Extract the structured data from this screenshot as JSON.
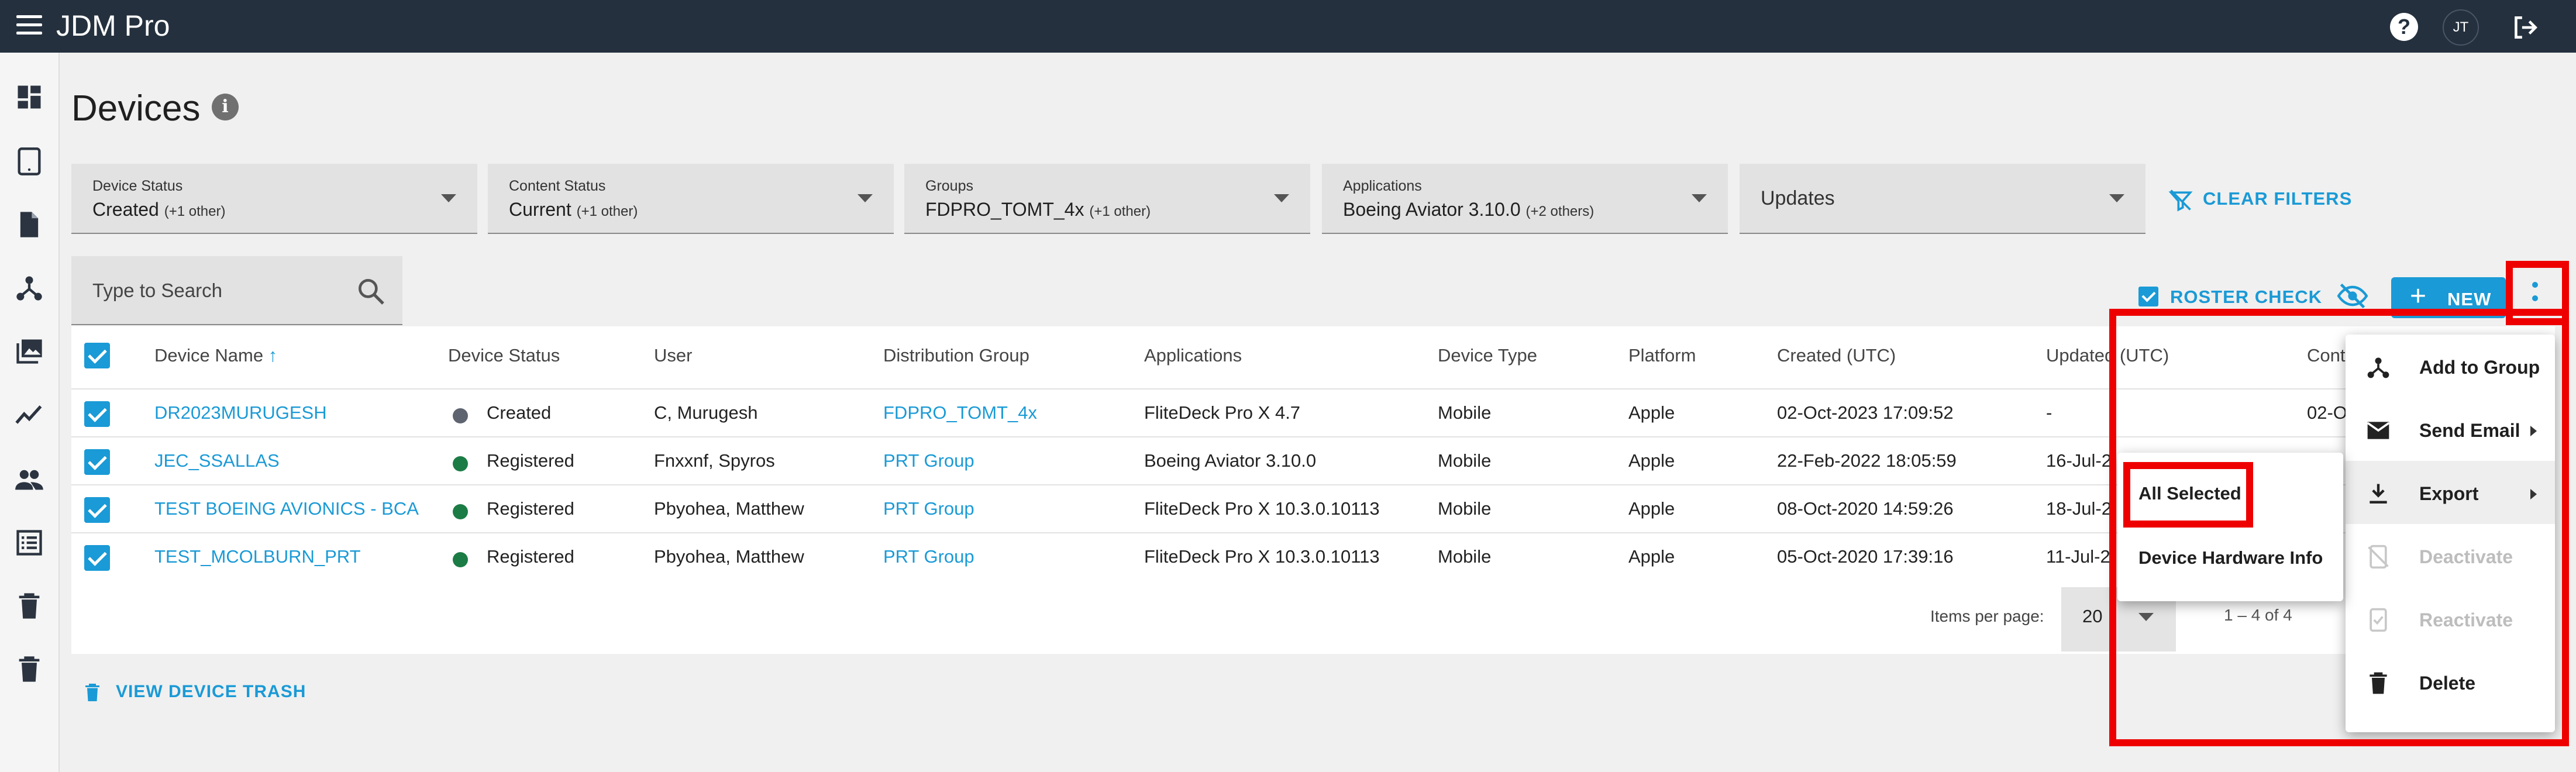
{
  "app": {
    "title": "JDM Pro",
    "user_initials": "JT"
  },
  "page": {
    "title": "Devices"
  },
  "filters": [
    {
      "label": "Device Status",
      "value": "Created",
      "extra": "(+1 other)"
    },
    {
      "label": "Content Status",
      "value": "Current",
      "extra": "(+1 other)"
    },
    {
      "label": "Groups",
      "value": "FDPRO_TOMT_4x",
      "extra": "(+1 other)"
    },
    {
      "label": "Applications",
      "value": "Boeing Aviator 3.10.0",
      "extra": "(+2 others)"
    },
    {
      "label": "",
      "value": "Updates",
      "extra": ""
    }
  ],
  "clear_filters": "CLEAR FILTERS",
  "search": {
    "placeholder": "Type to Search"
  },
  "toolbar": {
    "roster_check": "ROSTER CHECK",
    "new_label": "NEW"
  },
  "table": {
    "headers": [
      "Device Name",
      "Device Status",
      "User",
      "Distribution Group",
      "Applications",
      "Device Type",
      "Platform",
      "Created (UTC)",
      "Updated (UTC)",
      "Cont"
    ],
    "rows": [
      {
        "name": "DR2023MURUGESH",
        "status": "Created",
        "status_color": "#5e6470",
        "user": "C, Murugesh",
        "group": "FDPRO_TOMT_4x",
        "apps": "FliteDeck Pro X 4.7",
        "type": "Mobile",
        "platform": "Apple",
        "created": "02-Oct-2023 17:09:52",
        "updated": "-",
        "cont": "02-O"
      },
      {
        "name": "JEC_SSALLAS",
        "status": "Registered",
        "status_color": "#1c7c45",
        "user": "Fnxxnf, Spyros",
        "group": "PRT Group",
        "apps": "Boeing Aviator 3.10.0",
        "type": "Mobile",
        "platform": "Apple",
        "created": "22-Feb-2022 18:05:59",
        "updated": "16-Jul-2",
        "cont": ""
      },
      {
        "name": "TEST BOEING AVIONICS - BCA",
        "status": "Registered",
        "status_color": "#1c7c45",
        "user": "Pbyohea, Matthew",
        "group": "PRT Group",
        "apps": "FliteDeck Pro X 10.3.0.10113",
        "type": "Mobile",
        "platform": "Apple",
        "created": "08-Oct-2020 14:59:26",
        "updated": "18-Jul-2",
        "cont": ""
      },
      {
        "name": "TEST_MCOLBURN_PRT",
        "status": "Registered",
        "status_color": "#1c7c45",
        "user": "Pbyohea, Matthew",
        "group": "PRT Group",
        "apps": "FliteDeck Pro X 10.3.0.10113",
        "type": "Mobile",
        "platform": "Apple",
        "created": "05-Oct-2020 17:39:16",
        "updated": "11-Jul-2",
        "cont": ""
      }
    ]
  },
  "pagination": {
    "items_per_page_label": "Items per page:",
    "items_per_page": "20",
    "range": "1 – 4 of 4"
  },
  "view_trash": "VIEW DEVICE TRASH",
  "actions_menu": [
    {
      "label": "Add to Group",
      "icon": "group-hierarchy-icon",
      "enabled": true
    },
    {
      "label": "Send Email",
      "icon": "email-icon",
      "enabled": true
    },
    {
      "label": "Export",
      "icon": "download-icon",
      "enabled": true
    },
    {
      "label": "Deactivate",
      "icon": "device-off-icon",
      "enabled": false
    },
    {
      "label": "Reactivate",
      "icon": "device-check-icon",
      "enabled": false
    },
    {
      "label": "Delete",
      "icon": "trash-icon",
      "enabled": true
    }
  ],
  "export_submenu": [
    "All Selected",
    "Device Hardware Info"
  ],
  "colors": {
    "topbar": "#24303e",
    "accent": "#1a9ad6",
    "highlight": "#ee0000"
  }
}
